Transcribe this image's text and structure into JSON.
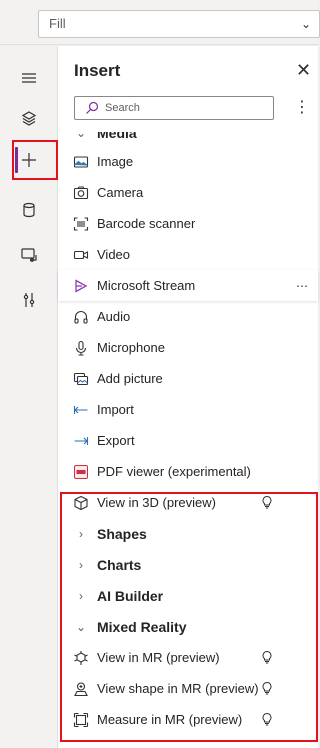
{
  "topbar": {
    "fill_value": "Fill"
  },
  "rail": {
    "items": [
      {
        "name": "menu",
        "icon": "hamburger-icon"
      },
      {
        "name": "tree-view",
        "icon": "layers-icon"
      },
      {
        "name": "insert",
        "icon": "plus-icon",
        "active": true
      },
      {
        "name": "data",
        "icon": "database-icon"
      },
      {
        "name": "media",
        "icon": "media-icon"
      },
      {
        "name": "advanced-tools",
        "icon": "tools-icon"
      }
    ]
  },
  "panel": {
    "title": "Insert",
    "search_placeholder": "Search",
    "items": [
      {
        "type": "group",
        "label": "Media",
        "expanded": true
      },
      {
        "type": "item",
        "label": "Image",
        "icon": "image-icon"
      },
      {
        "type": "item",
        "label": "Camera",
        "icon": "camera-icon"
      },
      {
        "type": "item",
        "label": "Barcode scanner",
        "icon": "barcode-icon"
      },
      {
        "type": "item",
        "label": "Video",
        "icon": "video-icon"
      },
      {
        "type": "item",
        "label": "Microsoft Stream",
        "icon": "stream-icon",
        "hover": true
      },
      {
        "type": "item",
        "label": "Audio",
        "icon": "headphones-icon"
      },
      {
        "type": "item",
        "label": "Microphone",
        "icon": "microphone-icon"
      },
      {
        "type": "item",
        "label": "Add picture",
        "icon": "add-picture-icon"
      },
      {
        "type": "item",
        "label": "Import",
        "icon": "import-icon"
      },
      {
        "type": "item",
        "label": "Export",
        "icon": "export-icon"
      },
      {
        "type": "item",
        "label": "PDF viewer (experimental)",
        "icon": "pdf-icon"
      },
      {
        "type": "item",
        "label": "View in 3D (preview)",
        "icon": "cube-icon",
        "bulb": true
      },
      {
        "type": "group",
        "label": "Shapes",
        "expanded": false
      },
      {
        "type": "group",
        "label": "Charts",
        "expanded": false
      },
      {
        "type": "group",
        "label": "AI Builder",
        "expanded": false
      },
      {
        "type": "group",
        "label": "Mixed Reality",
        "expanded": true
      },
      {
        "type": "item",
        "label": "View in MR (preview)",
        "icon": "view-mr-icon",
        "bulb": true
      },
      {
        "type": "item",
        "label": "View shape in MR (preview)",
        "icon": "shape-mr-icon",
        "bulb": true
      },
      {
        "type": "item",
        "label": "Measure in MR (preview)",
        "icon": "measure-mr-icon",
        "bulb": true
      }
    ]
  },
  "colors": {
    "accent": "#7a2a9a",
    "highlight": "#e3121b",
    "stream_icon": "#8b3fb5"
  }
}
